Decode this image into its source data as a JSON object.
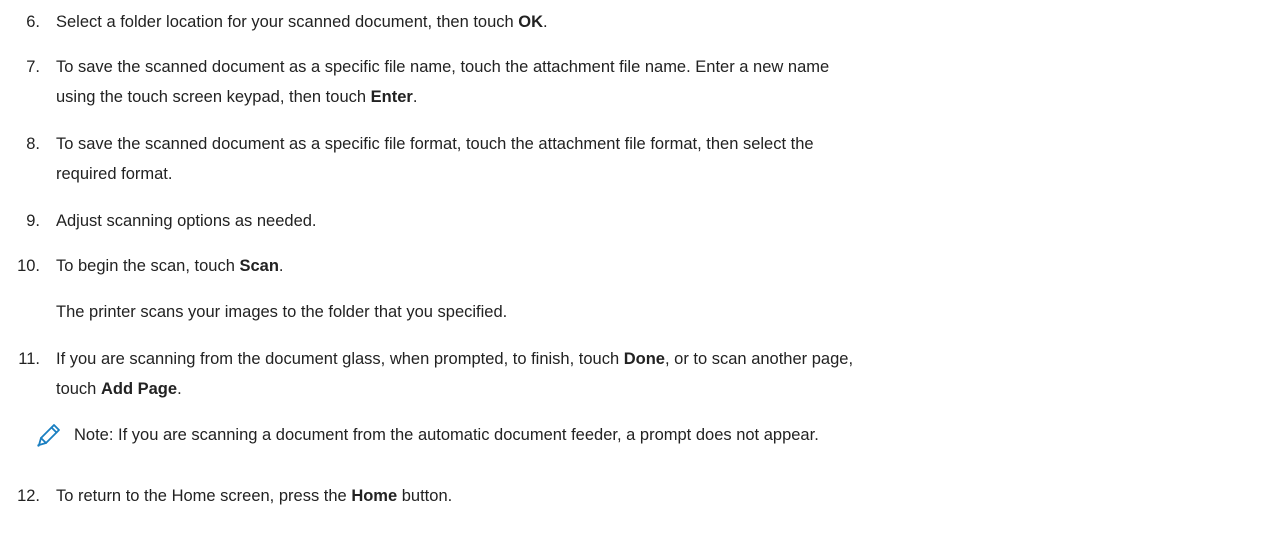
{
  "steps": [
    {
      "num": "6.",
      "parts": [
        {
          "t": "Select a folder location for your scanned document, then touch "
        },
        {
          "t": "OK",
          "b": true
        },
        {
          "t": "."
        }
      ]
    },
    {
      "num": "7.",
      "parts": [
        {
          "t": "To save the scanned document as a specific file name, touch the attachment file name. Enter a new name"
        }
      ],
      "parts2": [
        {
          "t": "using the touch screen keypad, then touch "
        },
        {
          "t": "Enter",
          "b": true
        },
        {
          "t": "."
        }
      ]
    },
    {
      "num": "8.",
      "parts": [
        {
          "t": "To save the scanned document as a specific file format, touch the attachment file format, then select the"
        }
      ],
      "parts2": [
        {
          "t": "required format."
        }
      ]
    },
    {
      "num": "9.",
      "parts": [
        {
          "t": "Adjust scanning options as needed."
        }
      ]
    },
    {
      "num": "10.",
      "parts": [
        {
          "t": "To begin the scan, touch "
        },
        {
          "t": "Scan",
          "b": true
        },
        {
          "t": "."
        }
      ],
      "sub": "The printer scans your images to the folder that you specified."
    },
    {
      "num": "11.",
      "parts": [
        {
          "t": "If you are scanning from the document glass, when prompted, to finish, touch "
        },
        {
          "t": "Done",
          "b": true
        },
        {
          "t": ", or to scan another page,"
        }
      ],
      "parts2": [
        {
          "t": "touch "
        },
        {
          "t": "Add Page",
          "b": true
        },
        {
          "t": "."
        }
      ]
    },
    {
      "num": "12.",
      "parts": [
        {
          "t": "To return to the Home screen, press the "
        },
        {
          "t": "Home",
          "b": true
        },
        {
          "t": " button."
        }
      ]
    }
  ],
  "note": {
    "icon": "pencil-icon",
    "text": "Note: If you are scanning a document from the automatic document feeder, a prompt does not appear."
  },
  "colors": {
    "text": "#222222",
    "icon": "#1a7fc1"
  }
}
